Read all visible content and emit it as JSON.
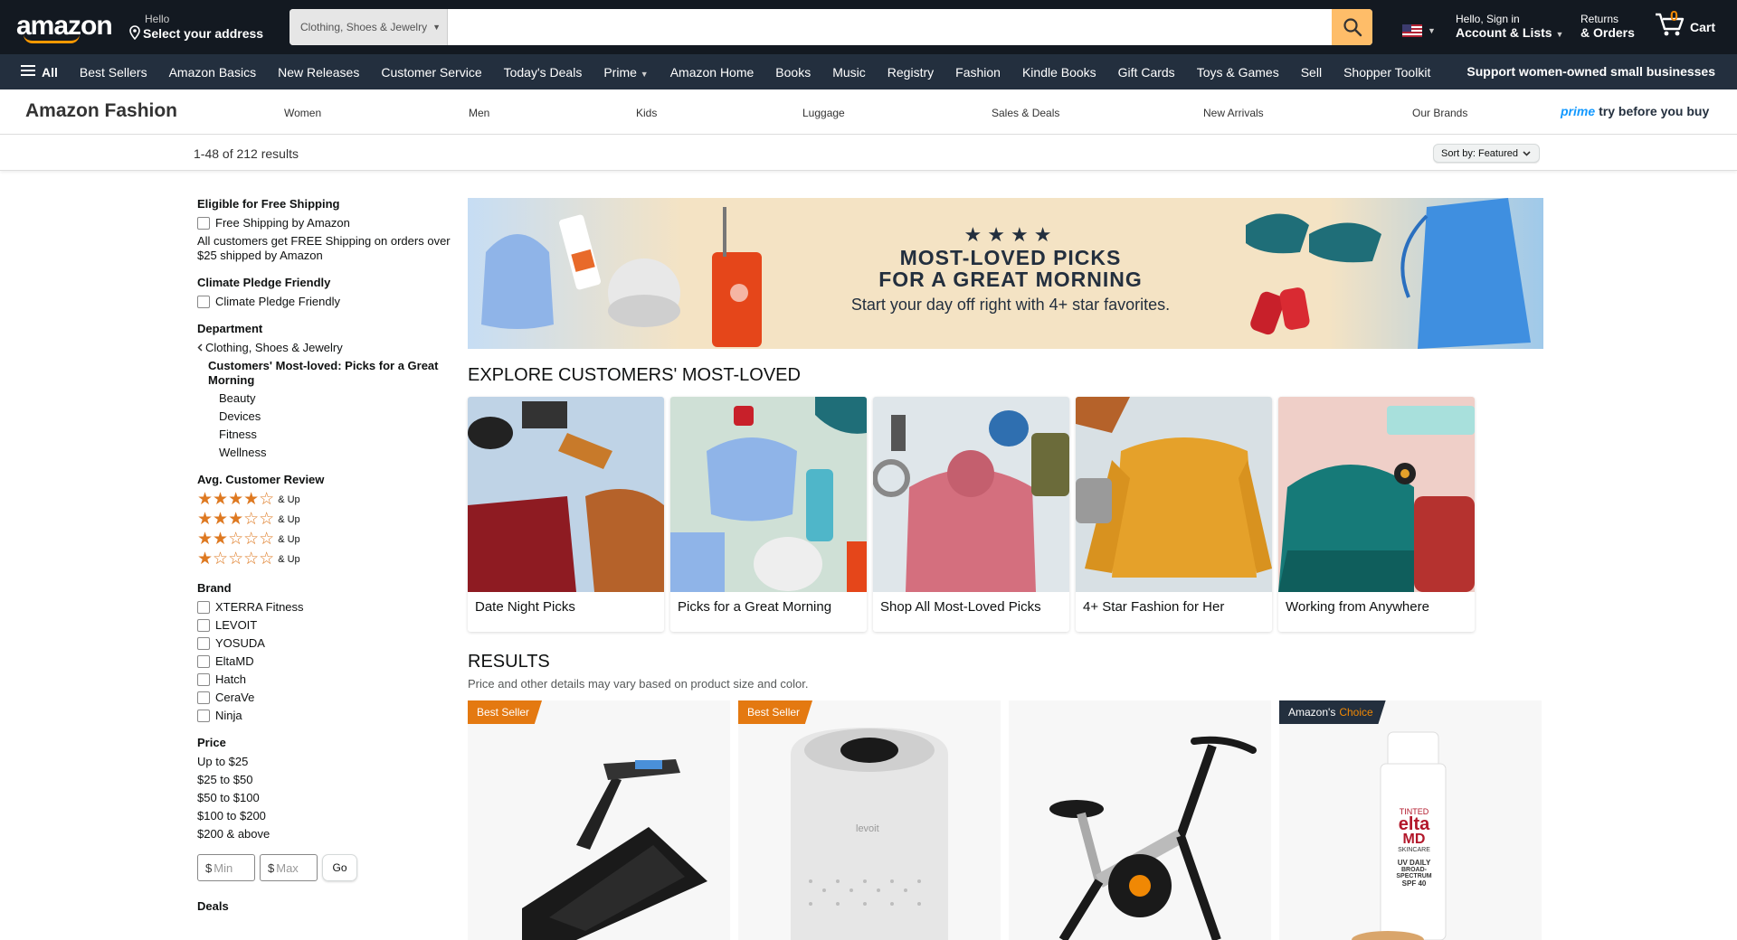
{
  "nav": {
    "logo": "amazon",
    "deliver_small": "Hello",
    "deliver_big": "Select your address",
    "search_dept": "Clothing, Shoes & Jewelry",
    "search_placeholder": "",
    "account_small": "Hello, Sign in",
    "account_big": "Account & Lists",
    "returns_small": "Returns",
    "returns_big": "& Orders",
    "cart_count": "0",
    "cart_label": "Cart"
  },
  "subnav": {
    "all": "All",
    "items": [
      "Best Sellers",
      "Amazon Basics",
      "New Releases",
      "Customer Service",
      "Today's Deals",
      "Prime",
      "Amazon Home",
      "Books",
      "Music",
      "Registry",
      "Fashion",
      "Kindle Books",
      "Gift Cards",
      "Toys & Games",
      "Sell",
      "Shopper Toolkit"
    ],
    "support": "Support women-owned small businesses"
  },
  "fashion": {
    "title": "Amazon Fashion",
    "links": [
      "Women",
      "Men",
      "Kids",
      "Luggage",
      "Sales & Deals",
      "New Arrivals",
      "Our Brands"
    ],
    "prime": "prime",
    "try": "try before you buy"
  },
  "results": {
    "count": "1-48 of 212 results",
    "sort_label": "Sort by:",
    "sort_value": "Featured"
  },
  "sidebar": {
    "shipping_h": "Eligible for Free Shipping",
    "shipping_opt": "Free Shipping by Amazon",
    "shipping_note": "All customers get FREE Shipping on orders over $25 shipped by Amazon",
    "climate_h": "Climate Pledge Friendly",
    "climate_opt": "Climate Pledge Friendly",
    "dept_h": "Department",
    "dept_parent": "Clothing, Shoes & Jewelry",
    "dept_current": "Customers' Most-loved: Picks for a Great Morning",
    "dept_children": [
      "Beauty",
      "Devices",
      "Fitness",
      "Wellness"
    ],
    "review_h": "Avg. Customer Review",
    "review_rows": [
      4,
      3,
      2,
      1
    ],
    "review_suffix": "& Up",
    "brand_h": "Brand",
    "brands": [
      "XTERRA Fitness",
      "LEVOIT",
      "YOSUDA",
      "EltaMD",
      "Hatch",
      "CeraVe",
      "Ninja"
    ],
    "price_h": "Price",
    "prices": [
      "Up to $25",
      "$25 to $50",
      "$50 to $100",
      "$100 to $200",
      "$200 & above"
    ],
    "min_ph": "Min",
    "max_ph": "Max",
    "go": "Go",
    "deals_h": "Deals"
  },
  "banner": {
    "stars": "★★★★",
    "line1": "MOST-LOVED PICKS",
    "line2": "FOR A GREAT MORNING",
    "sub": "Start your day off right with 4+ star favorites."
  },
  "explore": {
    "title": "EXPLORE CUSTOMERS' MOST-LOVED",
    "tiles": [
      {
        "label": "Date Night Picks"
      },
      {
        "label": "Picks for a Great Morning"
      },
      {
        "label": "Shop All Most-Loved Picks"
      },
      {
        "label": "4+ Star Fashion for Her"
      },
      {
        "label": "Working from Anywhere"
      }
    ]
  },
  "results_section": {
    "title": "RESULTS",
    "note": "Price and other details may vary based on product size and color.",
    "badges": [
      "Best Seller",
      "Best Seller",
      "",
      "Amazon's"
    ],
    "choice": "Choice",
    "product4_text": {
      "a": "TINTED",
      "b": "elta",
      "c": "MD",
      "d": "SKINCARE",
      "e": "UV DAILY",
      "f": "BROAD-SPECTRUM",
      "g": "SPF 40"
    },
    "product2_brand": "levoit"
  }
}
